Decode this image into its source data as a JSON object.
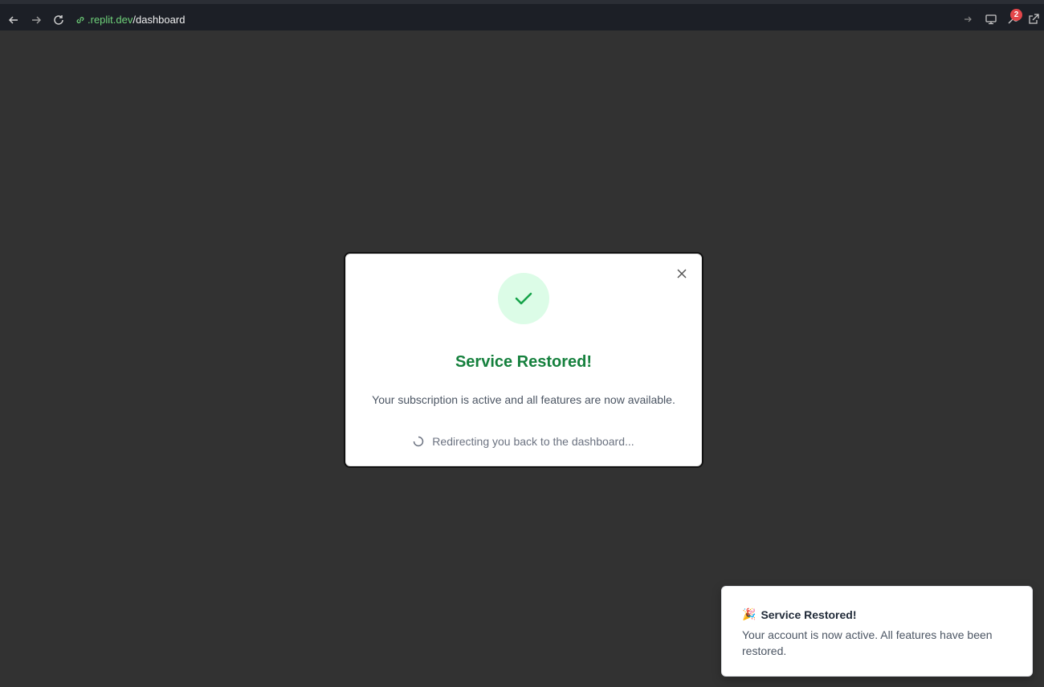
{
  "browser": {
    "url_domain": ".replit.dev",
    "url_path": "/dashboard",
    "notification_count": "2"
  },
  "modal": {
    "title": "Service Restored!",
    "description": "Your subscription is active and all features are now available.",
    "redirect_text": "Redirecting you back to the dashboard..."
  },
  "toast": {
    "emoji": "🎉",
    "title": "Service Restored!",
    "body": "Your account is now active. All features have been restored."
  },
  "colors": {
    "success": "#15803d",
    "success_bg": "#dcfce7",
    "badge": "#e4464a"
  }
}
